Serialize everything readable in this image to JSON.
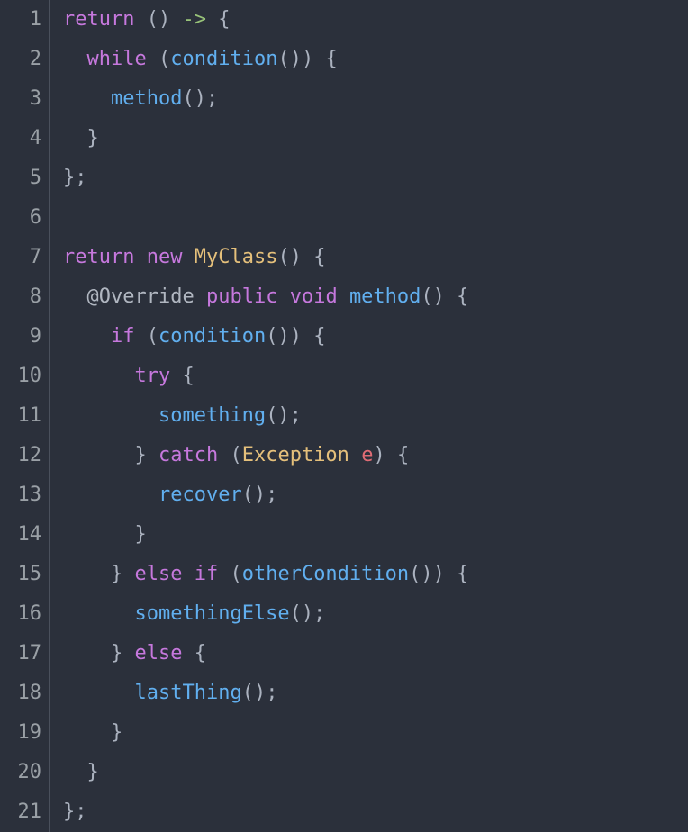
{
  "editor": {
    "line_numbers": [
      "1",
      "2",
      "3",
      "4",
      "5",
      "6",
      "7",
      "8",
      "9",
      "10",
      "11",
      "12",
      "13",
      "14",
      "15",
      "16",
      "17",
      "18",
      "19",
      "20",
      "21"
    ],
    "lines": [
      {
        "indent": 0,
        "tokens": [
          {
            "t": "return",
            "c": "keyword"
          },
          {
            "t": " ",
            "c": "plain"
          },
          {
            "t": "()",
            "c": "punc"
          },
          {
            "t": " ",
            "c": "plain"
          },
          {
            "t": "->",
            "c": "arrow"
          },
          {
            "t": " ",
            "c": "plain"
          },
          {
            "t": "{",
            "c": "punc"
          }
        ]
      },
      {
        "indent": 1,
        "tokens": [
          {
            "t": "while",
            "c": "keyword"
          },
          {
            "t": " ",
            "c": "plain"
          },
          {
            "t": "(",
            "c": "punc"
          },
          {
            "t": "condition",
            "c": "func"
          },
          {
            "t": "())",
            "c": "punc"
          },
          {
            "t": " ",
            "c": "plain"
          },
          {
            "t": "{",
            "c": "punc"
          }
        ]
      },
      {
        "indent": 2,
        "tokens": [
          {
            "t": "method",
            "c": "func"
          },
          {
            "t": "();",
            "c": "punc"
          }
        ]
      },
      {
        "indent": 1,
        "tokens": [
          {
            "t": "}",
            "c": "punc"
          }
        ]
      },
      {
        "indent": 0,
        "tokens": [
          {
            "t": "};",
            "c": "punc"
          }
        ]
      },
      {
        "indent": 0,
        "tokens": []
      },
      {
        "indent": 0,
        "tokens": [
          {
            "t": "return",
            "c": "keyword"
          },
          {
            "t": " ",
            "c": "plain"
          },
          {
            "t": "new",
            "c": "keyword"
          },
          {
            "t": " ",
            "c": "plain"
          },
          {
            "t": "MyClass",
            "c": "type"
          },
          {
            "t": "()",
            "c": "punc"
          },
          {
            "t": " ",
            "c": "plain"
          },
          {
            "t": "{",
            "c": "punc"
          }
        ]
      },
      {
        "indent": 1,
        "tokens": [
          {
            "t": "@Override",
            "c": "anno"
          },
          {
            "t": " ",
            "c": "plain"
          },
          {
            "t": "public",
            "c": "keyword"
          },
          {
            "t": " ",
            "c": "plain"
          },
          {
            "t": "void",
            "c": "keyword"
          },
          {
            "t": " ",
            "c": "plain"
          },
          {
            "t": "method",
            "c": "func"
          },
          {
            "t": "()",
            "c": "punc"
          },
          {
            "t": " ",
            "c": "plain"
          },
          {
            "t": "{",
            "c": "punc"
          }
        ]
      },
      {
        "indent": 2,
        "tokens": [
          {
            "t": "if",
            "c": "keyword"
          },
          {
            "t": " ",
            "c": "plain"
          },
          {
            "t": "(",
            "c": "punc"
          },
          {
            "t": "condition",
            "c": "func"
          },
          {
            "t": "())",
            "c": "punc"
          },
          {
            "t": " ",
            "c": "plain"
          },
          {
            "t": "{",
            "c": "punc"
          }
        ]
      },
      {
        "indent": 3,
        "tokens": [
          {
            "t": "try",
            "c": "keyword"
          },
          {
            "t": " ",
            "c": "plain"
          },
          {
            "t": "{",
            "c": "punc"
          }
        ]
      },
      {
        "indent": 4,
        "tokens": [
          {
            "t": "something",
            "c": "func"
          },
          {
            "t": "();",
            "c": "punc"
          }
        ]
      },
      {
        "indent": 3,
        "tokens": [
          {
            "t": "}",
            "c": "punc"
          },
          {
            "t": " ",
            "c": "plain"
          },
          {
            "t": "catch",
            "c": "keyword"
          },
          {
            "t": " ",
            "c": "plain"
          },
          {
            "t": "(",
            "c": "punc"
          },
          {
            "t": "Exception",
            "c": "type"
          },
          {
            "t": " ",
            "c": "plain"
          },
          {
            "t": "e",
            "c": "ident"
          },
          {
            "t": ")",
            "c": "punc"
          },
          {
            "t": " ",
            "c": "plain"
          },
          {
            "t": "{",
            "c": "punc"
          }
        ]
      },
      {
        "indent": 4,
        "tokens": [
          {
            "t": "recover",
            "c": "func"
          },
          {
            "t": "();",
            "c": "punc"
          }
        ]
      },
      {
        "indent": 3,
        "tokens": [
          {
            "t": "}",
            "c": "punc"
          }
        ]
      },
      {
        "indent": 2,
        "tokens": [
          {
            "t": "}",
            "c": "punc"
          },
          {
            "t": " ",
            "c": "plain"
          },
          {
            "t": "else",
            "c": "keyword"
          },
          {
            "t": " ",
            "c": "plain"
          },
          {
            "t": "if",
            "c": "keyword"
          },
          {
            "t": " ",
            "c": "plain"
          },
          {
            "t": "(",
            "c": "punc"
          },
          {
            "t": "otherCondition",
            "c": "func"
          },
          {
            "t": "())",
            "c": "punc"
          },
          {
            "t": " ",
            "c": "plain"
          },
          {
            "t": "{",
            "c": "punc"
          }
        ]
      },
      {
        "indent": 3,
        "tokens": [
          {
            "t": "somethingElse",
            "c": "func"
          },
          {
            "t": "();",
            "c": "punc"
          }
        ]
      },
      {
        "indent": 2,
        "tokens": [
          {
            "t": "}",
            "c": "punc"
          },
          {
            "t": " ",
            "c": "plain"
          },
          {
            "t": "else",
            "c": "keyword"
          },
          {
            "t": " ",
            "c": "plain"
          },
          {
            "t": "{",
            "c": "punc"
          }
        ]
      },
      {
        "indent": 3,
        "tokens": [
          {
            "t": "lastThing",
            "c": "func"
          },
          {
            "t": "();",
            "c": "punc"
          }
        ]
      },
      {
        "indent": 2,
        "tokens": [
          {
            "t": "}",
            "c": "punc"
          }
        ]
      },
      {
        "indent": 1,
        "tokens": [
          {
            "t": "}",
            "c": "punc"
          }
        ]
      },
      {
        "indent": 0,
        "tokens": [
          {
            "t": "};",
            "c": "punc"
          }
        ]
      }
    ]
  }
}
